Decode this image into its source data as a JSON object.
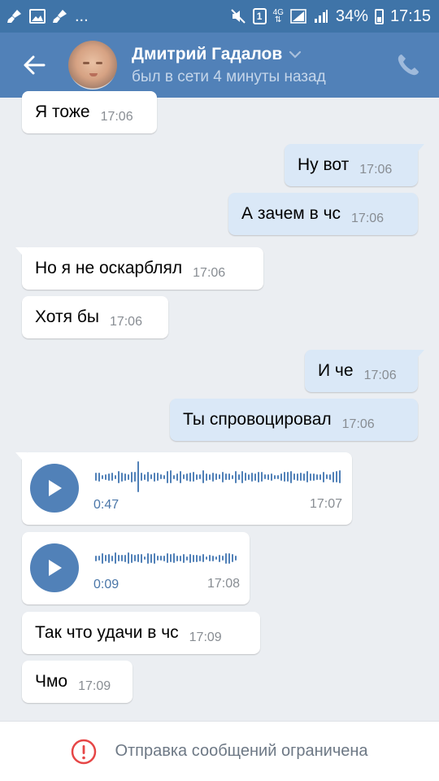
{
  "status_bar": {
    "left_icons": [
      "broom-icon",
      "image-icon",
      "broom-icon"
    ],
    "more": "...",
    "sim_slot": "1",
    "network": "4G",
    "battery": "34%",
    "time": "17:15"
  },
  "header": {
    "name": "Дмитрий Гадалов",
    "status": "был в сети 4 минуты назад",
    "colors": {
      "bar": "#5181b8",
      "status_bar": "#3f74a8"
    }
  },
  "messages": [
    {
      "dir": "in",
      "text": "Я тоже",
      "time": "17:06"
    },
    {
      "dir": "out",
      "text": "Ну вот",
      "time": "17:06"
    },
    {
      "dir": "out",
      "text": "А зачем в чс",
      "time": "17:06"
    },
    {
      "dir": "in",
      "text": "Но я не оскарблял",
      "time": "17:06"
    },
    {
      "dir": "in",
      "text": "Хотя бы",
      "time": "17:06"
    },
    {
      "dir": "out",
      "text": "И че",
      "time": "17:06"
    },
    {
      "dir": "out",
      "text": "Ты спровоцировал",
      "time": "17:06"
    },
    {
      "dir": "in",
      "type": "voice",
      "duration": "0:47",
      "time": "17:07"
    },
    {
      "dir": "in",
      "type": "voice",
      "duration": "0:09",
      "time": "17:08"
    },
    {
      "dir": "in",
      "text": "Так что удачи в чс",
      "time": "17:09"
    },
    {
      "dir": "in",
      "text": "Чмо",
      "time": "17:09"
    }
  ],
  "footer": {
    "restriction_text": "Отправка сообщений ограничена",
    "alert_color": "#e64646"
  }
}
